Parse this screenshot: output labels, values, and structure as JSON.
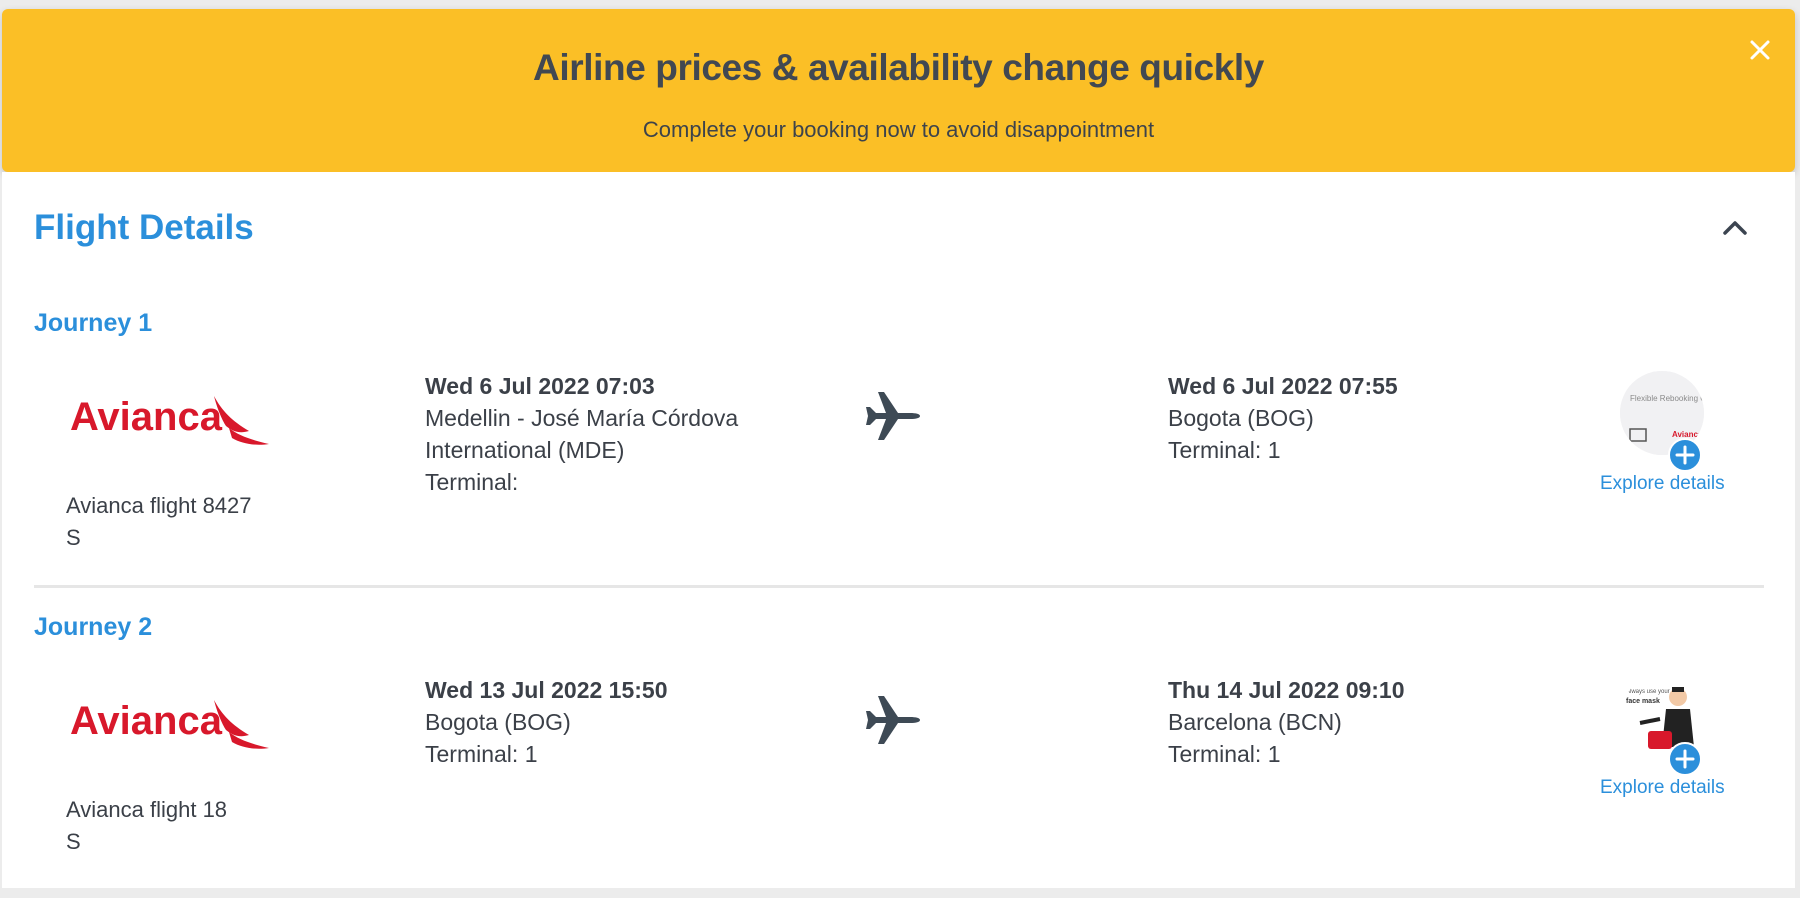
{
  "banner": {
    "title": "Airline prices & availability change quickly",
    "subtitle": "Complete your booking now to avoid disappointment",
    "close_icon": "close-icon",
    "color": "#fbbf26"
  },
  "section": {
    "title": "Flight Details",
    "collapse_icon": "chevron-up-icon",
    "accent_color": "#2b8fdb"
  },
  "journeys": [
    {
      "title": "Journey 1",
      "airline_logo_text": "Avianca",
      "flight_line1": "Avianca flight 8427",
      "flight_line2": "S",
      "departure": {
        "datetime": "Wed 6 Jul 2022 07:03",
        "airport_line1": "Medellin - José María Córdova",
        "airport_line2": "International (MDE)",
        "terminal": "Terminal:"
      },
      "arrival": {
        "datetime": "Wed 6 Jul 2022 07:55",
        "airport": "Bogota (BOG)",
        "terminal": "Terminal: 1"
      },
      "extra": {
        "thumb_text": "Flexible Rebooking Options",
        "thumb_brand": "Avianca",
        "link": "Explore details"
      }
    },
    {
      "title": "Journey 2",
      "airline_logo_text": "Avianca",
      "flight_line1": "Avianca flight 18",
      "flight_line2": "S",
      "departure": {
        "datetime": "Wed 13 Jul 2022 15:50",
        "airport_line1": "Bogota (BOG)",
        "terminal": "Terminal: 1"
      },
      "arrival": {
        "datetime": "Thu 14 Jul 2022 09:10",
        "airport": "Barcelona (BCN)",
        "terminal": "Terminal: 1"
      },
      "extra": {
        "thumb_text_small": "Always use your",
        "thumb_text_bold": "face mask",
        "link": "Explore details"
      }
    }
  ]
}
